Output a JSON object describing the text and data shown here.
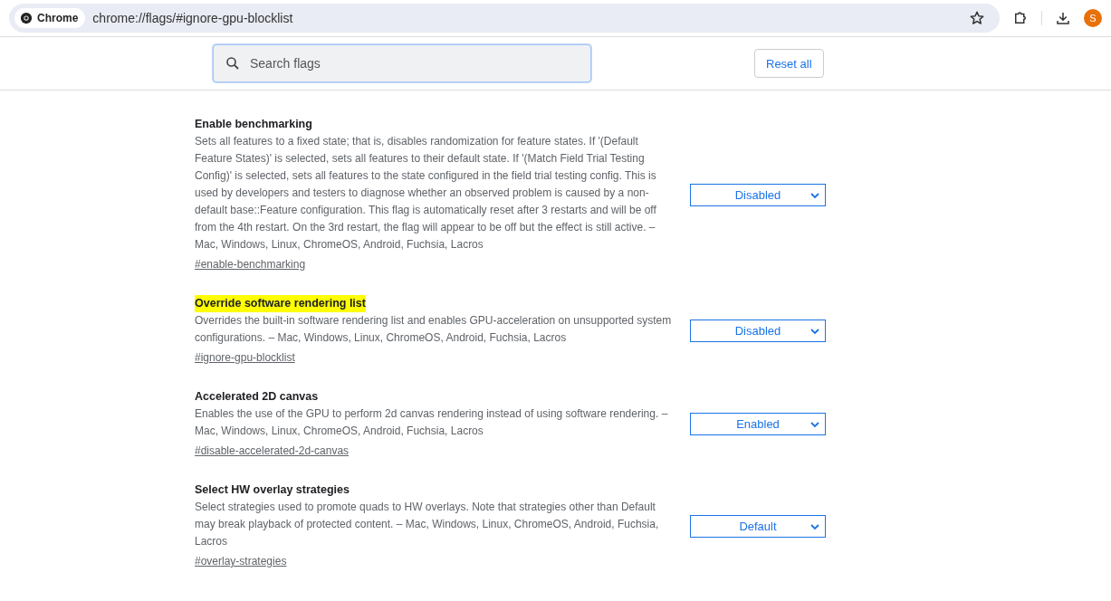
{
  "browser": {
    "chip_label": "Chrome",
    "url": "chrome://flags/#ignore-gpu-blocklist",
    "avatar_letter": "S"
  },
  "search": {
    "placeholder": "Search flags"
  },
  "reset_button": "Reset all",
  "flags": [
    {
      "title": "Enable benchmarking",
      "highlighted": false,
      "description": "Sets all features to a fixed state; that is, disables randomization for feature states. If '(Default Feature States)' is selected, sets all features to their default state. If '(Match Field Trial Testing Config)' is selected, sets all features to the state configured in the field trial testing config. This is used by developers and testers to diagnose whether an observed problem is caused by a non-default base::Feature configuration. This flag is automatically reset after 3 restarts and will be off from the 4th restart. On the 3rd restart, the flag will appear to be off but the effect is still active. – Mac, Windows, Linux, ChromeOS, Android, Fuchsia, Lacros",
      "link": "#enable-benchmarking",
      "value": "Disabled"
    },
    {
      "title": "Override software rendering list",
      "highlighted": true,
      "description": "Overrides the built-in software rendering list and enables GPU-acceleration on unsupported system configurations. – Mac, Windows, Linux, ChromeOS, Android, Fuchsia, Lacros",
      "link": "#ignore-gpu-blocklist",
      "value": "Disabled"
    },
    {
      "title": "Accelerated 2D canvas",
      "highlighted": false,
      "description": "Enables the use of the GPU to perform 2d canvas rendering instead of using software rendering. – Mac, Windows, Linux, ChromeOS, Android, Fuchsia, Lacros",
      "link": "#disable-accelerated-2d-canvas",
      "value": "Enabled"
    },
    {
      "title": "Select HW overlay strategies",
      "highlighted": false,
      "description": "Select strategies used to promote quads to HW overlays. Note that strategies other than Default may break playback of protected content. – Mac, Windows, Linux, ChromeOS, Android, Fuchsia, Lacros",
      "link": "#overlay-strategies",
      "value": "Default"
    }
  ]
}
